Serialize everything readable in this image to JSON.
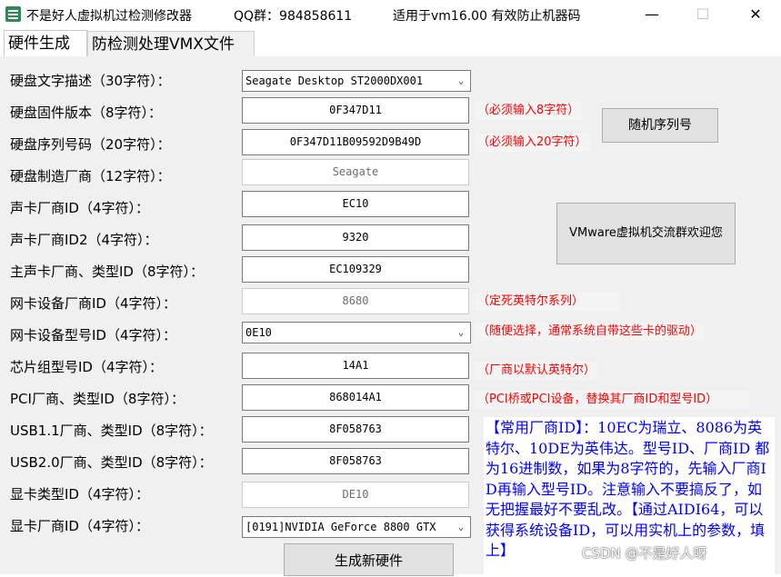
{
  "window": {
    "title_parts": [
      "不是好人虚拟机过检测修改器",
      "QQ群：984858611",
      "适用于vm16.00  有效防止机器码"
    ],
    "minimize": "—",
    "maximize": "☐",
    "close": "✕"
  },
  "tabs": [
    {
      "label": "硬件生成",
      "active": true
    },
    {
      "label": "防检测处理VMX文件",
      "active": false
    }
  ],
  "rows": [
    {
      "label": "硬盘文字描述（30字符）：",
      "type": "combo",
      "value": "Seagate Desktop ST2000DX001"
    },
    {
      "label": "硬盘固件版本（8字符）：",
      "type": "field",
      "value": "0F347D11"
    },
    {
      "label": "硬盘序列号码（20字符）：",
      "type": "field",
      "value": "0F347D11B09592D9B49D"
    },
    {
      "label": "硬盘制造厂商（12字符）：",
      "type": "field-disabled",
      "value": "Seagate"
    },
    {
      "label": "声卡厂商ID（4字符）：",
      "type": "field",
      "value": "EC10"
    },
    {
      "label": "声卡厂商ID2（4字符）：",
      "type": "field",
      "value": "9320"
    },
    {
      "label": "主声卡厂商、类型ID（8字符）：",
      "type": "field",
      "value": "EC109329"
    },
    {
      "label": "网卡设备厂商ID（4字符）：",
      "type": "field-disabled",
      "value": "8680"
    },
    {
      "label": "网卡设备型号ID（4字符）：",
      "type": "combo",
      "value": "0E10"
    },
    {
      "label": "芯片组型号ID（4字符）：",
      "type": "field",
      "value": "14A1"
    },
    {
      "label": "PCI厂商、类型ID（8字符）：",
      "type": "field",
      "value": "868014A1"
    },
    {
      "label": "USB1.1厂商、类型ID（8字符）：",
      "type": "field",
      "value": "8F058763"
    },
    {
      "label": "USB2.0厂商、类型ID（8字符）：",
      "type": "field",
      "value": "8F058763"
    },
    {
      "label": "显卡类型ID（4字符）：",
      "type": "field-disabled",
      "value": "DE10"
    },
    {
      "label": "显卡厂商ID（4字符）：",
      "type": "combo",
      "value": "[0191]NVIDIA GeForce 8800 GTX"
    }
  ],
  "notes": {
    "firmware": "（必须输入8字符）",
    "serial": "（必须输入20字符）",
    "nic_vendor": "（定死英特尔系列）",
    "nic_model": "（随便选择，通常系统自带这些卡的驱动）",
    "chipset": "（厂商以默认英特尔）",
    "pci": "（PCI桥或PCI设备，替换其厂商ID和型号ID）"
  },
  "buttons": {
    "random_serial": "随机序列号",
    "vmware_group": "VMware虚拟机交流群欢迎您",
    "generate": "生成新硬件"
  },
  "info_text": "【常用厂商ID】：10EC为瑞立、8086为英特尔、10DE为英伟达。型号ID、厂商ID 都为16进制数，如果为8字符的，先输入厂商ID再输入型号ID。注意输入不要搞反了，如无把握最好不要乱改。【通过AIDI64，可以获得系统设备ID，可以用实机上的参数，填上】",
  "watermark": "CSDN @不是好人呀",
  "colors": {
    "note": "#ff0000",
    "info": "#0000ff"
  }
}
